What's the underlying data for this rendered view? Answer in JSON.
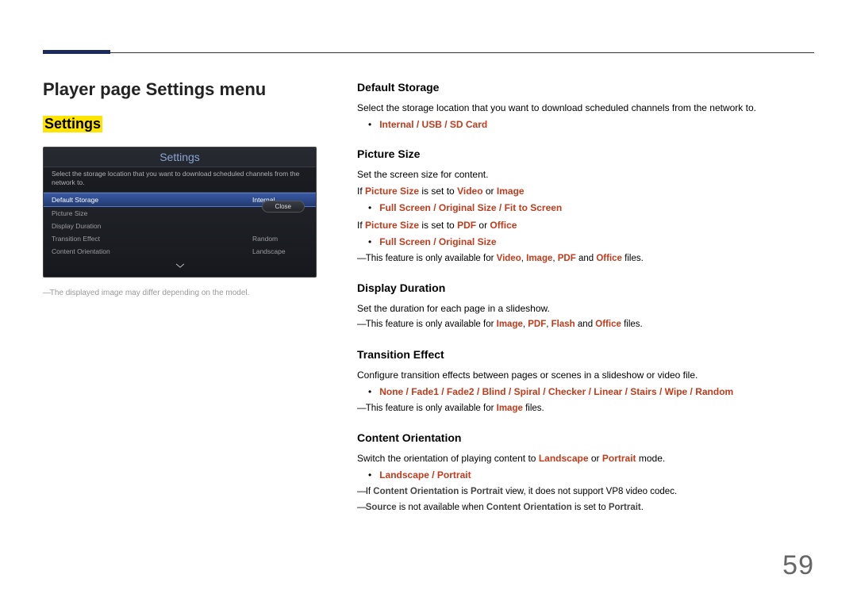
{
  "page_number": "59",
  "left": {
    "title": "Player page Settings menu",
    "section": "Settings",
    "caption": "The displayed image may differ depending on the model.",
    "panel": {
      "title": "Settings",
      "desc": "Select the storage location that you want to download scheduled channels from the network to.",
      "close": "Close",
      "rows": [
        {
          "label": "Default Storage",
          "value": "Internal"
        },
        {
          "label": "Picture Size",
          "value": ""
        },
        {
          "label": "Display Duration",
          "value": ""
        },
        {
          "label": "Transition Effect",
          "value": "Random"
        },
        {
          "label": "Content Orientation",
          "value": "Landscape"
        }
      ]
    }
  },
  "right": {
    "default_storage": {
      "h": "Default Storage",
      "p1": "Select the storage location that you want to download scheduled channels from the network to.",
      "opt": "Internal / USB / SD Card"
    },
    "picture_size": {
      "h": "Picture Size",
      "p1": "Set the screen size for content.",
      "p2a": "If ",
      "p2b": "Picture Size",
      "p2c": " is set to ",
      "p2d": "Video",
      "p2e": " or ",
      "p2f": "Image",
      "opt1": "Full Screen / Original Size / Fit to Screen",
      "p3a": "If ",
      "p3b": "Picture Size",
      "p3c": " is set to ",
      "p3d": "PDF",
      "p3e": " or ",
      "p3f": "Office",
      "opt2": "Full Screen / Original Size",
      "n1a": "This feature is only available for ",
      "n1b": "Video",
      "n1c": ", ",
      "n1d": "Image",
      "n1e": ", ",
      "n1f": "PDF",
      "n1g": " and ",
      "n1h": "Office",
      "n1i": " files."
    },
    "display_duration": {
      "h": "Display Duration",
      "p1": "Set the duration for each page in a slideshow.",
      "n1a": "This feature is only available for ",
      "n1b": "Image",
      "n1c": ", ",
      "n1d": "PDF",
      "n1e": ", ",
      "n1f": "Flash",
      "n1g": " and ",
      "n1h": "Office",
      "n1i": " files."
    },
    "transition": {
      "h": "Transition Effect",
      "p1": "Configure transition effects between pages or scenes in a slideshow or video file.",
      "opt": "None / Fade1 / Fade2 / Blind / Spiral / Checker / Linear / Stairs / Wipe / Random",
      "n1a": "This feature is only available for ",
      "n1b": "Image",
      "n1c": " files."
    },
    "orientation": {
      "h": "Content Orientation",
      "p1a": "Switch the orientation of playing content to ",
      "p1b": "Landscape",
      "p1c": " or ",
      "p1d": "Portrait",
      "p1e": " mode.",
      "opt": "Landscape / Portrait",
      "n1a": "If ",
      "n1b": "Content Orientation",
      "n1c": " is ",
      "n1d": "Portrait",
      "n1e": " view, it does not support VP8 video codec.",
      "n2a": "Source",
      "n2b": " is not available when ",
      "n2c": "Content Orientation",
      "n2d": " is set to ",
      "n2e": "Portrait",
      "n2f": "."
    }
  }
}
